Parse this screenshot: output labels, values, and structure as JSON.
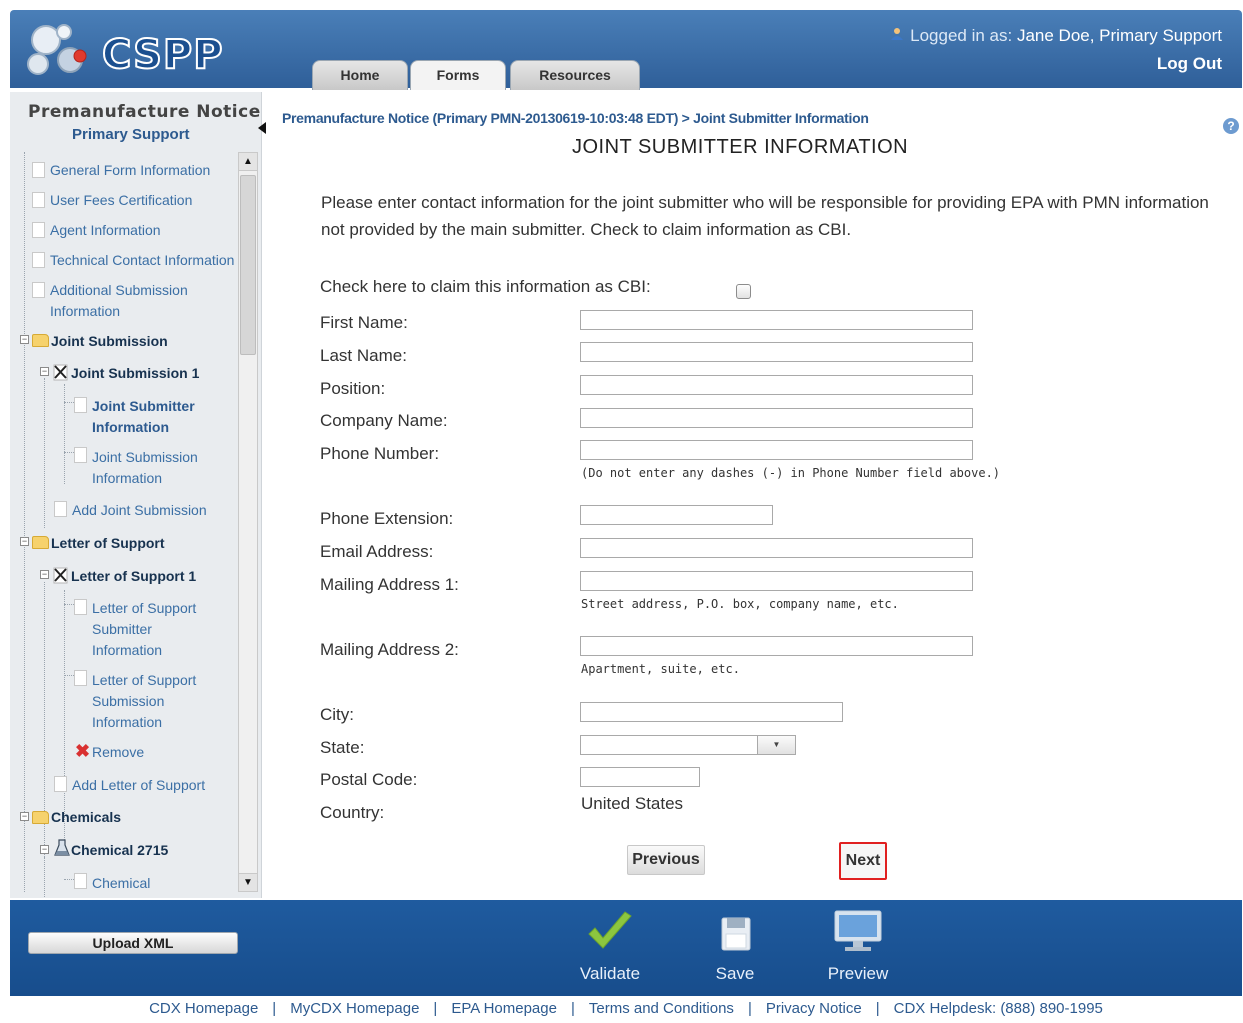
{
  "header": {
    "logo_text": "CSPP",
    "tabs": [
      {
        "label": "Home"
      },
      {
        "label": "Forms"
      },
      {
        "label": "Resources"
      }
    ],
    "logged_in_prefix": "Logged in as:",
    "user_name": "Jane Doe, Primary Support",
    "logout_label": "Log Out"
  },
  "sidebar": {
    "title": "Premanufacture Notice",
    "subtitle": "Primary Support",
    "items": [
      {
        "label": "General Form Information"
      },
      {
        "label": "User Fees Certification"
      },
      {
        "label": "Agent Information"
      },
      {
        "label": "Technical Contact Information"
      },
      {
        "label": "Additional Submission"
      },
      {
        "label": "Information"
      },
      {
        "label": "Joint Submission"
      },
      {
        "label": "Joint Submission 1"
      },
      {
        "label": "Joint Submitter"
      },
      {
        "label": "Information"
      },
      {
        "label": "Joint Submission"
      },
      {
        "label": "Information"
      },
      {
        "label": "Add Joint Submission"
      },
      {
        "label": "Letter of Support"
      },
      {
        "label": "Letter of Support 1"
      },
      {
        "label": "Letter of Support"
      },
      {
        "label": "Submitter"
      },
      {
        "label": "Information"
      },
      {
        "label": "Letter of Support"
      },
      {
        "label": "Submission"
      },
      {
        "label": "Information"
      },
      {
        "label": "Remove"
      },
      {
        "label": "Add Letter of Support"
      },
      {
        "label": "Chemicals"
      },
      {
        "label": "Chemical 2715"
      },
      {
        "label": "Chemical"
      }
    ]
  },
  "main": {
    "breadcrumb": "Premanufacture Notice (Primary PMN-20130619-10:03:48 EDT) > Joint Submitter Information",
    "title": "JOINT SUBMITTER INFORMATION",
    "instructions": "Please enter contact information for the joint submitter who will be responsible for providing EPA with PMN information not provided by the main submitter. Check to claim information as CBI.",
    "cbi_label": "Check here to claim this information as CBI:",
    "fields": {
      "first_name": {
        "label": "First Name:",
        "value": ""
      },
      "last_name": {
        "label": "Last Name:",
        "value": ""
      },
      "position": {
        "label": "Position:",
        "value": ""
      },
      "company_name": {
        "label": "Company Name:",
        "value": ""
      },
      "phone_number": {
        "label": "Phone Number:",
        "value": "",
        "hint": "(Do not enter any dashes (-) in Phone Number field above.)"
      },
      "phone_extension": {
        "label": "Phone Extension:",
        "value": ""
      },
      "email_address": {
        "label": "Email Address:",
        "value": ""
      },
      "mailing_address_1": {
        "label": "Mailing Address 1:",
        "value": "",
        "hint": "Street address, P.O. box, company name, etc."
      },
      "mailing_address_2": {
        "label": "Mailing Address 2:",
        "value": "",
        "hint": "Apartment, suite, etc."
      },
      "city": {
        "label": "City:",
        "value": ""
      },
      "state": {
        "label": "State:",
        "value": ""
      },
      "postal_code": {
        "label": "Postal Code:",
        "value": ""
      },
      "country": {
        "label": "Country:",
        "value": "United States"
      }
    },
    "previous_label": "Previous",
    "next_label": "Next"
  },
  "bottom_bar": {
    "upload_label": "Upload XML",
    "actions": [
      {
        "label": "Validate",
        "icon": "checkmark-icon"
      },
      {
        "label": "Save",
        "icon": "floppy-disk-icon"
      },
      {
        "label": "Preview",
        "icon": "monitor-icon"
      }
    ]
  },
  "footer": {
    "links": [
      {
        "label": "CDX Homepage"
      },
      {
        "label": "MyCDX Homepage"
      },
      {
        "label": "EPA Homepage"
      },
      {
        "label": "Terms and Conditions"
      },
      {
        "label": "Privacy Notice"
      },
      {
        "label": "CDX Helpdesk: (888) 890-1995"
      }
    ],
    "separator": "|"
  },
  "colors": {
    "header_blue": "#2f5f99",
    "link_blue": "#2d5a8f",
    "next_highlight": "#e02020",
    "validate_green": "#8cc63f"
  }
}
